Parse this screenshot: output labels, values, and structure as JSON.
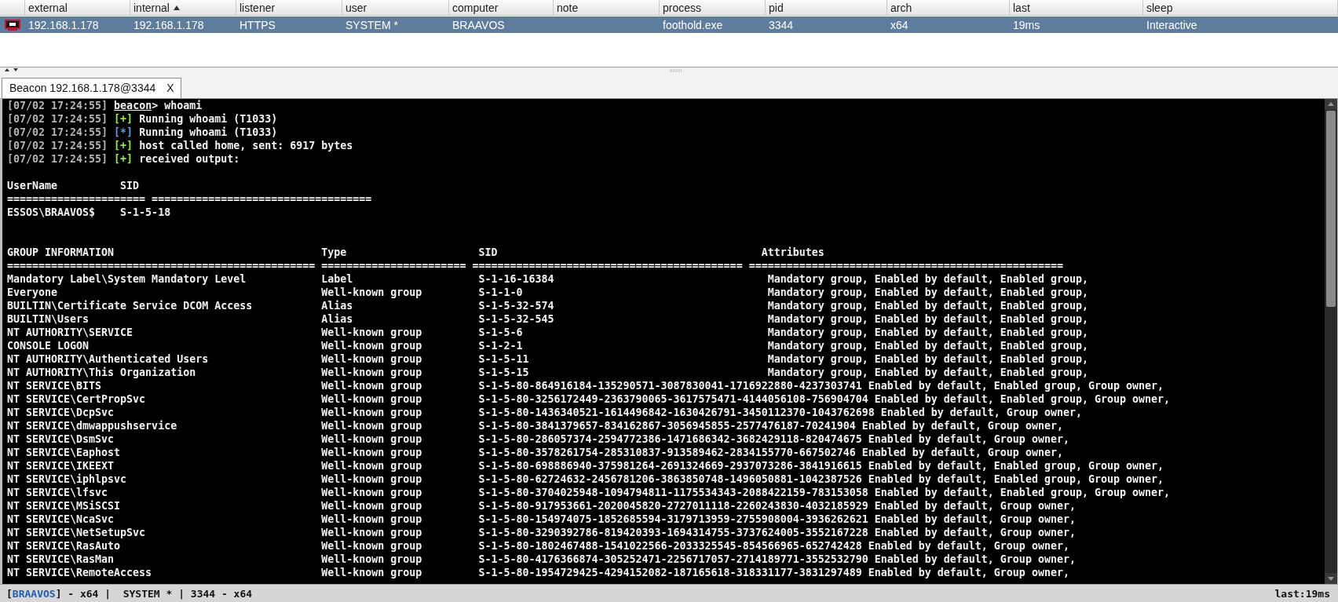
{
  "beacon_table": {
    "columns": [
      {
        "label": "external",
        "sorted": false
      },
      {
        "label": "internal",
        "sorted": true
      },
      {
        "label": "listener",
        "sorted": false
      },
      {
        "label": "user",
        "sorted": false
      },
      {
        "label": "computer",
        "sorted": false
      },
      {
        "label": "note",
        "sorted": false
      },
      {
        "label": "process",
        "sorted": false
      },
      {
        "label": "pid",
        "sorted": false
      },
      {
        "label": "arch",
        "sorted": false
      },
      {
        "label": "last",
        "sorted": false
      },
      {
        "label": "sleep",
        "sorted": false
      }
    ],
    "rows": [
      {
        "selected": true,
        "cells": [
          "192.168.1.178",
          "192.168.1.178",
          "HTTPS",
          "SYSTEM *",
          "BRAAVOS",
          "",
          "foothold.exe",
          "3344",
          "x64",
          "19ms",
          "Interactive"
        ]
      }
    ]
  },
  "tabs": [
    {
      "label": "Beacon 192.168.1.178@3344",
      "close": "X",
      "selected": true
    }
  ],
  "console": {
    "log": [
      {
        "kind": "prompt",
        "time": "[07/02 17:24:55]",
        "prompt": "beacon",
        "text": "> whoami"
      },
      {
        "kind": "log",
        "time": "[07/02 17:24:55]",
        "tag": "[+]",
        "color": "#8ef23c",
        "text": "Running whoami (T1033)"
      },
      {
        "kind": "log",
        "time": "[07/02 17:24:55]",
        "tag": "[*]",
        "color": "#5c9ee6",
        "text": "Running whoami (T1033)"
      },
      {
        "kind": "log",
        "time": "[07/02 17:24:55]",
        "tag": "[+]",
        "color": "#8ef23c",
        "text": "host called home, sent: 6917 bytes"
      },
      {
        "kind": "log",
        "time": "[07/02 17:24:55]",
        "tag": "[+]",
        "color": "#8ef23c",
        "text": "received output:"
      }
    ],
    "user_table": {
      "headers": [
        "UserName",
        "SID"
      ],
      "separator": "====================== ===================================",
      "rows": [
        {
          "name": "ESSOS\\BRAAVOS$",
          "sid": "S-1-5-18"
        }
      ]
    },
    "group_table": {
      "headers": [
        "GROUP INFORMATION",
        "Type",
        "SID",
        "Attributes"
      ],
      "separator": "================================================= ======================= =========================================== ==================================================",
      "rows": [
        {
          "name": "Mandatory Label\\System Mandatory Level",
          "type": "Label",
          "sid": "S-1-16-16384",
          "attributes": "Mandatory group, Enabled by default, Enabled group,"
        },
        {
          "name": "Everyone",
          "type": "Well-known group",
          "sid": "S-1-1-0",
          "attributes": "Mandatory group, Enabled by default, Enabled group,"
        },
        {
          "name": "BUILTIN\\Certificate Service DCOM Access",
          "type": "Alias",
          "sid": "S-1-5-32-574",
          "attributes": "Mandatory group, Enabled by default, Enabled group,"
        },
        {
          "name": "BUILTIN\\Users",
          "type": "Alias",
          "sid": "S-1-5-32-545",
          "attributes": "Mandatory group, Enabled by default, Enabled group,"
        },
        {
          "name": "NT AUTHORITY\\SERVICE",
          "type": "Well-known group",
          "sid": "S-1-5-6",
          "attributes": "Mandatory group, Enabled by default, Enabled group,"
        },
        {
          "name": "CONSOLE LOGON",
          "type": "Well-known group",
          "sid": "S-1-2-1",
          "attributes": "Mandatory group, Enabled by default, Enabled group,"
        },
        {
          "name": "NT AUTHORITY\\Authenticated Users",
          "type": "Well-known group",
          "sid": "S-1-5-11",
          "attributes": "Mandatory group, Enabled by default, Enabled group,"
        },
        {
          "name": "NT AUTHORITY\\This Organization",
          "type": "Well-known group",
          "sid": "S-1-5-15",
          "attributes": "Mandatory group, Enabled by default, Enabled group,"
        },
        {
          "name": "NT SERVICE\\BITS",
          "type": "Well-known group",
          "sid": "S-1-5-80-864916184-135290571-3087830041-1716922880-4237303741",
          "attributes": "Enabled by default, Enabled group, Group owner,"
        },
        {
          "name": "NT SERVICE\\CertPropSvc",
          "type": "Well-known group",
          "sid": "S-1-5-80-3256172449-2363790065-3617575471-4144056108-756904704",
          "attributes": "Enabled by default, Enabled group, Group owner,"
        },
        {
          "name": "NT SERVICE\\DcpSvc",
          "type": "Well-known group",
          "sid": "S-1-5-80-1436340521-1614496842-1630426791-3450112370-1043762698",
          "attributes": "Enabled by default, Group owner,"
        },
        {
          "name": "NT SERVICE\\dmwappushservice",
          "type": "Well-known group",
          "sid": "S-1-5-80-3841379657-834162867-3056945855-2577476187-70241904",
          "attributes": "Enabled by default, Group owner,"
        },
        {
          "name": "NT SERVICE\\DsmSvc",
          "type": "Well-known group",
          "sid": "S-1-5-80-286057374-2594772386-1471686342-3682429118-820474675",
          "attributes": "Enabled by default, Group owner,"
        },
        {
          "name": "NT SERVICE\\Eaphost",
          "type": "Well-known group",
          "sid": "S-1-5-80-3578261754-285310837-913589462-2834155770-667502746",
          "attributes": "Enabled by default, Group owner,"
        },
        {
          "name": "NT SERVICE\\IKEEXT",
          "type": "Well-known group",
          "sid": "S-1-5-80-698886940-375981264-2691324669-2937073286-3841916615",
          "attributes": "Enabled by default, Enabled group, Group owner,"
        },
        {
          "name": "NT SERVICE\\iphlpsvc",
          "type": "Well-known group",
          "sid": "S-1-5-80-62724632-2456781206-3863850748-1496050881-1042387526",
          "attributes": "Enabled by default, Enabled group, Group owner,"
        },
        {
          "name": "NT SERVICE\\lfsvc",
          "type": "Well-known group",
          "sid": "S-1-5-80-3704025948-1094794811-1175534343-2088422159-783153058",
          "attributes": "Enabled by default, Enabled group, Group owner,"
        },
        {
          "name": "NT SERVICE\\MSiSCSI",
          "type": "Well-known group",
          "sid": "S-1-5-80-917953661-2020045820-2727011118-2260243830-4032185929",
          "attributes": "Enabled by default, Group owner,"
        },
        {
          "name": "NT SERVICE\\NcaSvc",
          "type": "Well-known group",
          "sid": "S-1-5-80-154974075-1852685594-3179713959-2755908004-3936262621",
          "attributes": "Enabled by default, Group owner,"
        },
        {
          "name": "NT SERVICE\\NetSetupSvc",
          "type": "Well-known group",
          "sid": "S-1-5-80-3290392786-819420393-1694314755-3737624005-3552167228",
          "attributes": "Enabled by default, Group owner,"
        },
        {
          "name": "NT SERVICE\\RasAuto",
          "type": "Well-known group",
          "sid": "S-1-5-80-1802467488-1541022566-2033325545-854566965-652742428",
          "attributes": "Enabled by default, Group owner,"
        },
        {
          "name": "NT SERVICE\\RasMan",
          "type": "Well-known group",
          "sid": "S-1-5-80-4176366874-305252471-2256717057-2714189771-3552532790",
          "attributes": "Enabled by default, Group owner,"
        },
        {
          "name": "NT SERVICE\\RemoteAccess",
          "type": "Well-known group",
          "sid": "S-1-5-80-1954729425-4294152082-187165618-318331177-3831297489",
          "attributes": "Enabled by default, Group owner,"
        }
      ]
    }
  },
  "status_bar": {
    "segments": [
      {
        "kind": "plain",
        "text": "["
      },
      {
        "kind": "highlight",
        "text": "BRAAVOS"
      },
      {
        "kind": "plain",
        "text": "] - x64 |  SYSTEM * | 3344 - x64"
      }
    ],
    "right": "last:19ms"
  }
}
